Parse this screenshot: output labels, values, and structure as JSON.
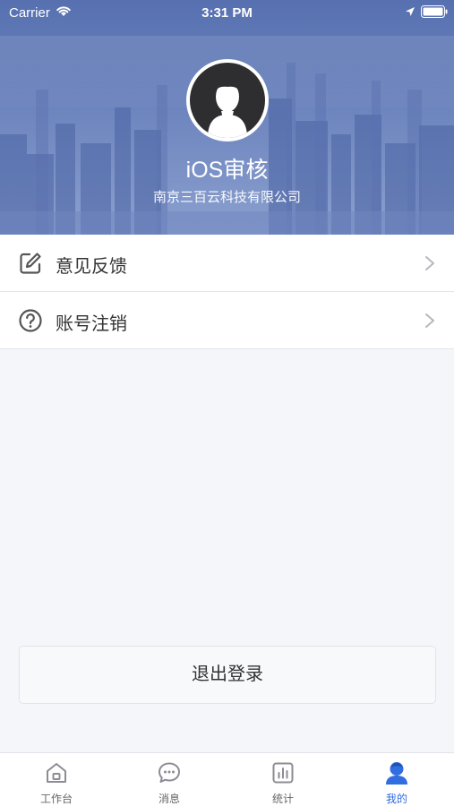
{
  "status_bar": {
    "carrier": "Carrier",
    "time": "3:31 PM",
    "icons": [
      "wifi-icon",
      "location-icon",
      "battery-icon"
    ]
  },
  "profile": {
    "avatar_icon": "user-avatar-icon",
    "name": "iOS审核",
    "company": "南京三百云科技有限公司"
  },
  "menu": {
    "items": [
      {
        "label": "意见反馈",
        "icon": "edit-icon"
      },
      {
        "label": "账号注销",
        "icon": "help-circle-icon"
      }
    ]
  },
  "logout_label": "退出登录",
  "tabbar": {
    "active_color": "#2f6de0",
    "inactive_color": "#8c8c96",
    "tabs": [
      {
        "label": "工作台",
        "icon": "home-icon",
        "active": false
      },
      {
        "label": "消息",
        "icon": "message-icon",
        "active": false
      },
      {
        "label": "统计",
        "icon": "stats-icon",
        "active": false
      },
      {
        "label": "我的",
        "icon": "profile-icon",
        "active": true
      }
    ]
  }
}
